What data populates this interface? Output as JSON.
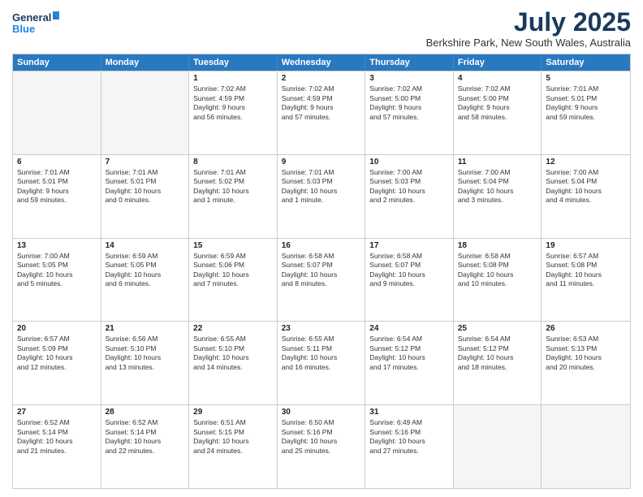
{
  "logo": {
    "line1": "General",
    "line2": "Blue"
  },
  "title": "July 2025",
  "subtitle": "Berkshire Park, New South Wales, Australia",
  "days": [
    "Sunday",
    "Monday",
    "Tuesday",
    "Wednesday",
    "Thursday",
    "Friday",
    "Saturday"
  ],
  "rows": [
    [
      {
        "day": "",
        "empty": true
      },
      {
        "day": "",
        "empty": true
      },
      {
        "day": "1",
        "line1": "Sunrise: 7:02 AM",
        "line2": "Sunset: 4:59 PM",
        "line3": "Daylight: 9 hours",
        "line4": "and 56 minutes."
      },
      {
        "day": "2",
        "line1": "Sunrise: 7:02 AM",
        "line2": "Sunset: 4:59 PM",
        "line3": "Daylight: 9 hours",
        "line4": "and 57 minutes."
      },
      {
        "day": "3",
        "line1": "Sunrise: 7:02 AM",
        "line2": "Sunset: 5:00 PM",
        "line3": "Daylight: 9 hours",
        "line4": "and 57 minutes."
      },
      {
        "day": "4",
        "line1": "Sunrise: 7:02 AM",
        "line2": "Sunset: 5:00 PM",
        "line3": "Daylight: 9 hours",
        "line4": "and 58 minutes."
      },
      {
        "day": "5",
        "line1": "Sunrise: 7:01 AM",
        "line2": "Sunset: 5:01 PM",
        "line3": "Daylight: 9 hours",
        "line4": "and 59 minutes."
      }
    ],
    [
      {
        "day": "6",
        "line1": "Sunrise: 7:01 AM",
        "line2": "Sunset: 5:01 PM",
        "line3": "Daylight: 9 hours",
        "line4": "and 59 minutes."
      },
      {
        "day": "7",
        "line1": "Sunrise: 7:01 AM",
        "line2": "Sunset: 5:01 PM",
        "line3": "Daylight: 10 hours",
        "line4": "and 0 minutes."
      },
      {
        "day": "8",
        "line1": "Sunrise: 7:01 AM",
        "line2": "Sunset: 5:02 PM",
        "line3": "Daylight: 10 hours",
        "line4": "and 1 minute."
      },
      {
        "day": "9",
        "line1": "Sunrise: 7:01 AM",
        "line2": "Sunset: 5:03 PM",
        "line3": "Daylight: 10 hours",
        "line4": "and 1 minute."
      },
      {
        "day": "10",
        "line1": "Sunrise: 7:00 AM",
        "line2": "Sunset: 5:03 PM",
        "line3": "Daylight: 10 hours",
        "line4": "and 2 minutes."
      },
      {
        "day": "11",
        "line1": "Sunrise: 7:00 AM",
        "line2": "Sunset: 5:04 PM",
        "line3": "Daylight: 10 hours",
        "line4": "and 3 minutes."
      },
      {
        "day": "12",
        "line1": "Sunrise: 7:00 AM",
        "line2": "Sunset: 5:04 PM",
        "line3": "Daylight: 10 hours",
        "line4": "and 4 minutes."
      }
    ],
    [
      {
        "day": "13",
        "line1": "Sunrise: 7:00 AM",
        "line2": "Sunset: 5:05 PM",
        "line3": "Daylight: 10 hours",
        "line4": "and 5 minutes."
      },
      {
        "day": "14",
        "line1": "Sunrise: 6:59 AM",
        "line2": "Sunset: 5:05 PM",
        "line3": "Daylight: 10 hours",
        "line4": "and 6 minutes."
      },
      {
        "day": "15",
        "line1": "Sunrise: 6:59 AM",
        "line2": "Sunset: 5:06 PM",
        "line3": "Daylight: 10 hours",
        "line4": "and 7 minutes."
      },
      {
        "day": "16",
        "line1": "Sunrise: 6:58 AM",
        "line2": "Sunset: 5:07 PM",
        "line3": "Daylight: 10 hours",
        "line4": "and 8 minutes."
      },
      {
        "day": "17",
        "line1": "Sunrise: 6:58 AM",
        "line2": "Sunset: 5:07 PM",
        "line3": "Daylight: 10 hours",
        "line4": "and 9 minutes."
      },
      {
        "day": "18",
        "line1": "Sunrise: 6:58 AM",
        "line2": "Sunset: 5:08 PM",
        "line3": "Daylight: 10 hours",
        "line4": "and 10 minutes."
      },
      {
        "day": "19",
        "line1": "Sunrise: 6:57 AM",
        "line2": "Sunset: 5:08 PM",
        "line3": "Daylight: 10 hours",
        "line4": "and 11 minutes."
      }
    ],
    [
      {
        "day": "20",
        "line1": "Sunrise: 6:57 AM",
        "line2": "Sunset: 5:09 PM",
        "line3": "Daylight: 10 hours",
        "line4": "and 12 minutes."
      },
      {
        "day": "21",
        "line1": "Sunrise: 6:56 AM",
        "line2": "Sunset: 5:10 PM",
        "line3": "Daylight: 10 hours",
        "line4": "and 13 minutes."
      },
      {
        "day": "22",
        "line1": "Sunrise: 6:55 AM",
        "line2": "Sunset: 5:10 PM",
        "line3": "Daylight: 10 hours",
        "line4": "and 14 minutes."
      },
      {
        "day": "23",
        "line1": "Sunrise: 6:55 AM",
        "line2": "Sunset: 5:11 PM",
        "line3": "Daylight: 10 hours",
        "line4": "and 16 minutes."
      },
      {
        "day": "24",
        "line1": "Sunrise: 6:54 AM",
        "line2": "Sunset: 5:12 PM",
        "line3": "Daylight: 10 hours",
        "line4": "and 17 minutes."
      },
      {
        "day": "25",
        "line1": "Sunrise: 6:54 AM",
        "line2": "Sunset: 5:12 PM",
        "line3": "Daylight: 10 hours",
        "line4": "and 18 minutes."
      },
      {
        "day": "26",
        "line1": "Sunrise: 6:53 AM",
        "line2": "Sunset: 5:13 PM",
        "line3": "Daylight: 10 hours",
        "line4": "and 20 minutes."
      }
    ],
    [
      {
        "day": "27",
        "line1": "Sunrise: 6:52 AM",
        "line2": "Sunset: 5:14 PM",
        "line3": "Daylight: 10 hours",
        "line4": "and 21 minutes."
      },
      {
        "day": "28",
        "line1": "Sunrise: 6:52 AM",
        "line2": "Sunset: 5:14 PM",
        "line3": "Daylight: 10 hours",
        "line4": "and 22 minutes."
      },
      {
        "day": "29",
        "line1": "Sunrise: 6:51 AM",
        "line2": "Sunset: 5:15 PM",
        "line3": "Daylight: 10 hours",
        "line4": "and 24 minutes."
      },
      {
        "day": "30",
        "line1": "Sunrise: 6:50 AM",
        "line2": "Sunset: 5:16 PM",
        "line3": "Daylight: 10 hours",
        "line4": "and 25 minutes."
      },
      {
        "day": "31",
        "line1": "Sunrise: 6:49 AM",
        "line2": "Sunset: 5:16 PM",
        "line3": "Daylight: 10 hours",
        "line4": "and 27 minutes."
      },
      {
        "day": "",
        "empty": true
      },
      {
        "day": "",
        "empty": true
      }
    ]
  ]
}
